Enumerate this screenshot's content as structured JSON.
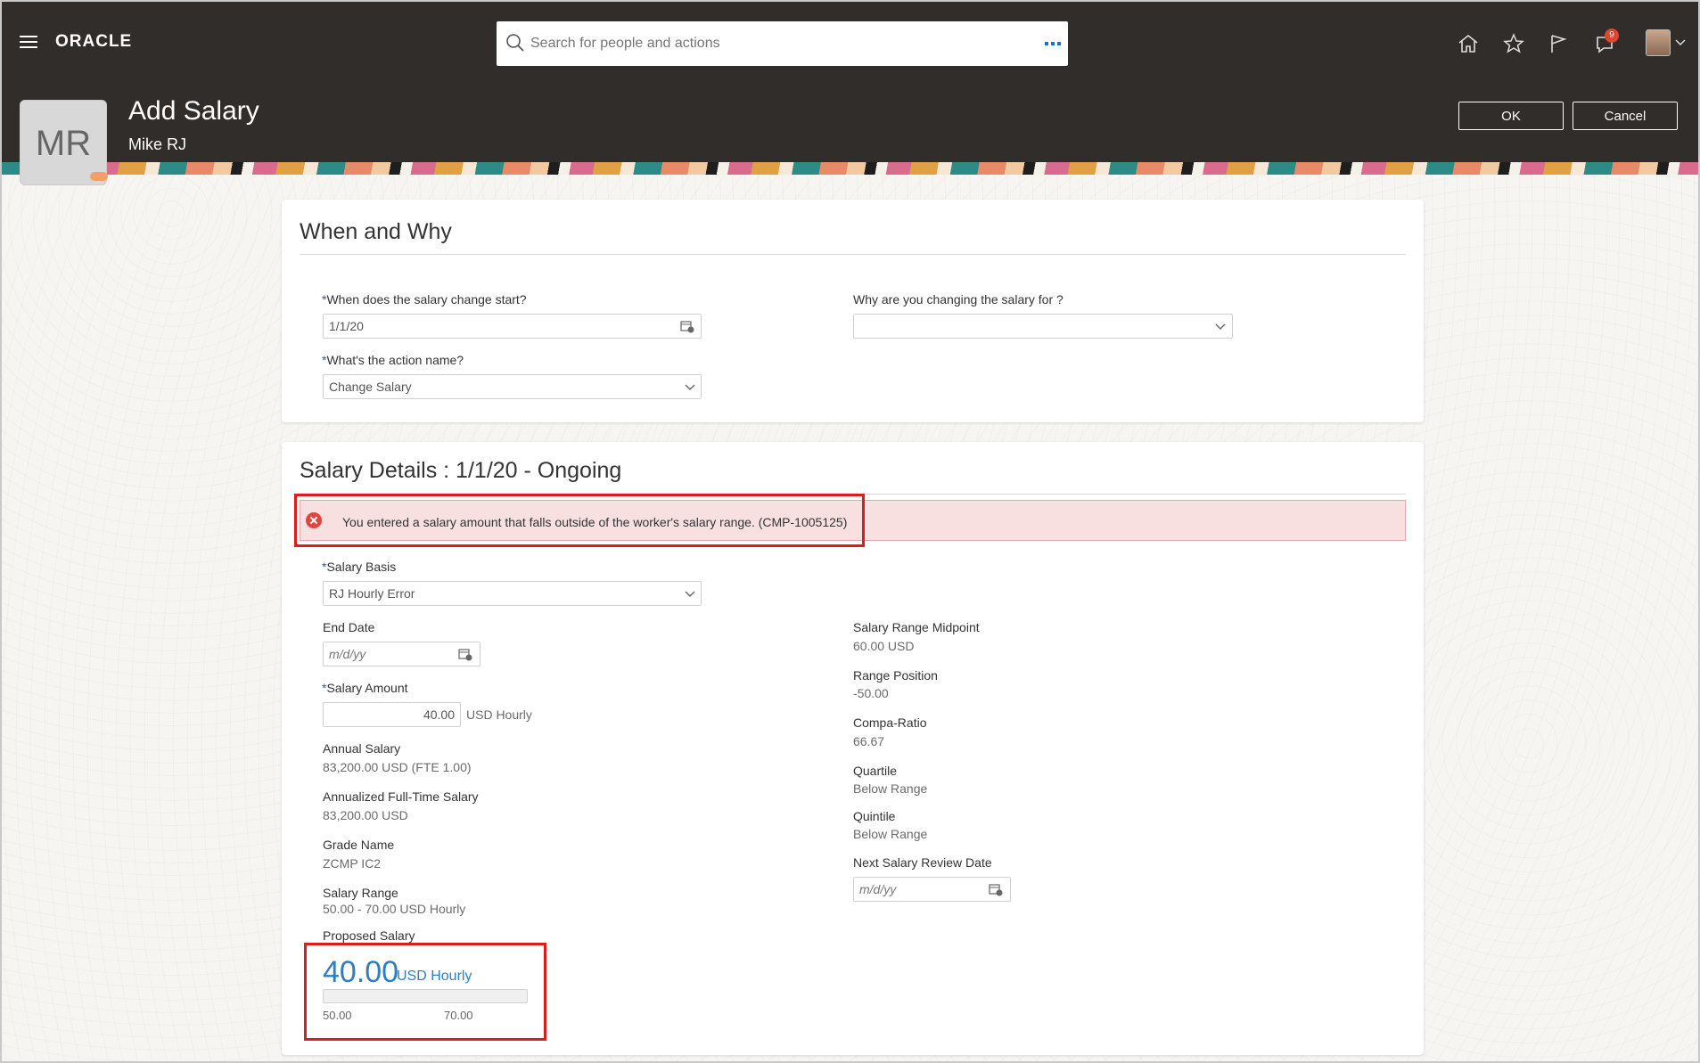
{
  "header": {
    "logo": "ORACLE",
    "search_placeholder": "Search for people and actions",
    "notifications_count": "9",
    "page_title": "Add Salary",
    "person_name": "Mike RJ",
    "person_initials": "MR",
    "ok_label": "OK",
    "cancel_label": "Cancel"
  },
  "when_why": {
    "title": "When and Why",
    "start_label": "When does the salary change start?",
    "start_value": "1/1/20",
    "action_label": "What's the action name?",
    "action_value": "Change Salary",
    "reason_label": "Why are you changing the salary for ?",
    "reason_value": ""
  },
  "salary_details": {
    "title": "Salary Details : 1/1/20 - Ongoing",
    "error_message": "You entered a salary amount that falls outside of the worker's salary range. (CMP-1005125)",
    "salary_basis_label": "Salary Basis",
    "salary_basis_value": "RJ Hourly Error",
    "end_date_label": "End Date",
    "date_placeholder": "m/d/yy",
    "salary_amount_label": "Salary Amount",
    "salary_amount_value": "40.00",
    "salary_amount_unit": "USD Hourly",
    "annual_salary_label": "Annual Salary",
    "annual_salary_value": "83,200.00  USD  (FTE  1.00)",
    "annualized_label": "Annualized Full-Time Salary",
    "annualized_value": "83,200.00  USD",
    "grade_name_label": "Grade Name",
    "grade_name_value": "ZCMP IC2",
    "salary_range_label": "Salary Range",
    "salary_range_value": "50.00  -  70.00  USD   Hourly",
    "proposed_label": "Proposed Salary",
    "proposed_amount": "40.00",
    "proposed_unit": "USD Hourly",
    "range_min": "50.00",
    "range_max": "70.00",
    "midpoint_label": "Salary Range Midpoint",
    "midpoint_value": "60.00  USD",
    "range_position_label": "Range Position",
    "range_position_value": "-50.00",
    "compa_ratio_label": "Compa-Ratio",
    "compa_ratio_value": "66.67",
    "quartile_label": "Quartile",
    "quartile_value": "Below Range",
    "quintile_label": "Quintile",
    "quintile_value": "Below Range",
    "next_review_label": "Next Salary Review Date"
  },
  "colors": {
    "header_bg": "#312d2a",
    "accent_blue": "#2f7fc0",
    "error_red": "#e01b1b",
    "error_bg": "#f9e0e0"
  },
  "icons": [
    "menu-icon",
    "search-icon",
    "home-icon",
    "star-icon",
    "flag-icon",
    "notifications-icon",
    "calendar-icon",
    "chevron-down-icon",
    "error-icon"
  ]
}
